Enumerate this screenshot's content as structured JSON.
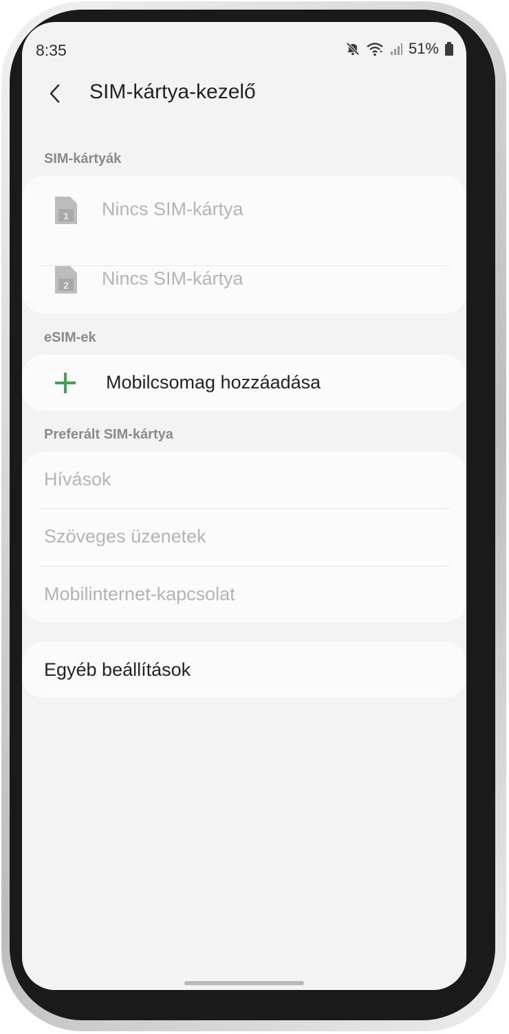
{
  "status_bar": {
    "time": "8:35",
    "battery": "51%",
    "icons": [
      "mute-icon",
      "wifi-icon",
      "signal-icon",
      "battery-icon"
    ]
  },
  "app_bar": {
    "title": "SIM-kártya-kezelő",
    "back_icon": "chevron-left-icon"
  },
  "sim_cards": {
    "header": "SIM-kártyák",
    "items": [
      {
        "slot": "1",
        "label": "Nincs SIM-kártya"
      },
      {
        "slot": "2",
        "label": "Nincs SIM-kártya"
      }
    ]
  },
  "esims": {
    "header": "eSIM-ek",
    "add_label": "Mobilcsomag hozzáadása"
  },
  "preferred_sim": {
    "header": "Preferált SIM-kártya",
    "items": [
      "Hívások",
      "Szöveges üzenetek",
      "Mobilinternet-kapcsolat"
    ]
  },
  "other_settings": {
    "label": "Egyéb beállítások"
  },
  "colors": {
    "accent_green": "#3aa655",
    "disabled_text": "#b4b4b4",
    "background": "#f3f3f3"
  }
}
